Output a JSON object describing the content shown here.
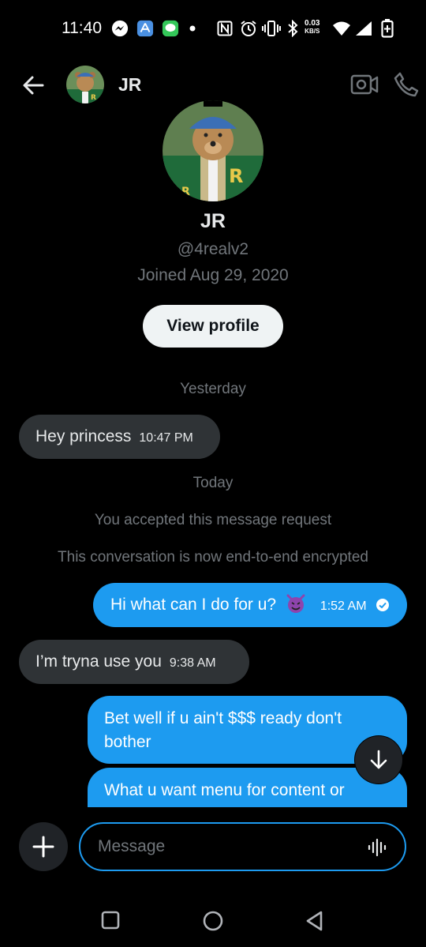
{
  "status_bar": {
    "time": "11:40",
    "net_speed_value": "0.03",
    "net_speed_unit": "KB/S",
    "icons": [
      "messenger-icon",
      "app-store-icon",
      "messages-icon",
      "dot-icon",
      "nfc-icon",
      "alarm-icon",
      "vibrate-icon",
      "bluetooth-icon",
      "wifi-icon",
      "signal-icon",
      "battery-icon"
    ]
  },
  "header": {
    "name": "JR"
  },
  "profile": {
    "name": "JR",
    "handle": "@4realv2",
    "joined": "Joined Aug 29, 2020",
    "view_profile_label": "View profile"
  },
  "conversation": {
    "day_yesterday": "Yesterday",
    "day_today": "Today",
    "system_accepted": "You accepted this message request",
    "system_encrypted": "This conversation is now end-to-end encrypted",
    "messages": [
      {
        "direction": "in",
        "text": "Hey princess",
        "time": "10:47 PM"
      },
      {
        "direction": "out",
        "text": "Hi what can I do for u?",
        "emoji": "smiling-devil",
        "time": "1:52 AM",
        "seen": true
      },
      {
        "direction": "in",
        "text": "I’m tryna use you",
        "time": "9:38 AM"
      },
      {
        "direction": "out",
        "text": "Bet well if u ain't $$$ ready don't bother"
      },
      {
        "direction": "out",
        "text": "What u want menu for content or"
      }
    ]
  },
  "composer": {
    "placeholder": "Message"
  },
  "colors": {
    "background": "#000000",
    "accent": "#1d9bf0",
    "incoming_bubble": "#2f3336",
    "muted_text": "#71767b"
  }
}
